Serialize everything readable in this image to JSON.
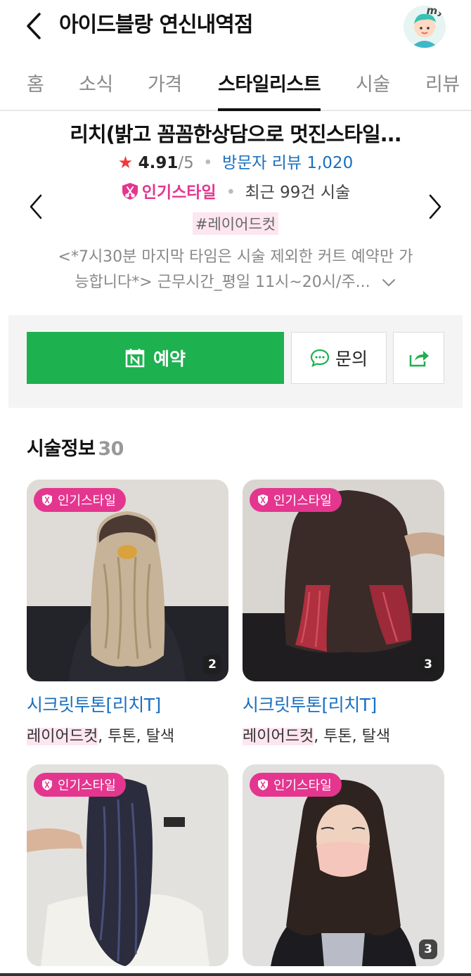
{
  "header": {
    "title": "아이드블랑 연신내역점",
    "avatar_label": "my"
  },
  "tabs": [
    {
      "label": "홈"
    },
    {
      "label": "소식"
    },
    {
      "label": "가격"
    },
    {
      "label": "스타일리스트"
    },
    {
      "label": "시술"
    },
    {
      "label": "리뷰"
    }
  ],
  "active_tab": "스타일리스트",
  "designer": {
    "name": "리치(밝고 꼼꼼한상담으로 멋진스타일...",
    "rating": "4.91",
    "rating_max": "/5",
    "review_label": "방문자 리뷰 1,020",
    "popular_label": "인기스타일",
    "recent_label": "최근 99건 시술",
    "hashtag": "#레이어드컷",
    "notice_line1": "<*7시30분 마지막 타임은 시술 제외한 커트 예약만 가",
    "notice_line2": "능합니다*> 근무시간_평일 11시~20시/주..."
  },
  "actions": {
    "reserve_label": "예약",
    "inquiry_label": "문의"
  },
  "services": {
    "title": "시술정보",
    "count": "30",
    "cards": [
      {
        "badge": "인기스타일",
        "count": "2",
        "title": "시크릿투톤[리치T]",
        "tag_highlight": "레이어드컷",
        "tags_rest": ", 투톤, 탈색"
      },
      {
        "badge": "인기스타일",
        "count": "3",
        "title": "시크릿투톤[리치T]",
        "tag_highlight": "레이어드컷",
        "tags_rest": ", 투톤, 탈색"
      },
      {
        "badge": "인기스타일",
        "count": ""
      },
      {
        "badge": "인기스타일",
        "count": "3"
      }
    ]
  },
  "colors": {
    "accent_green": "#1db14f",
    "badge_pink": "#e4368f",
    "link_blue": "#1a6fbf",
    "star_red": "#f03a3a"
  }
}
